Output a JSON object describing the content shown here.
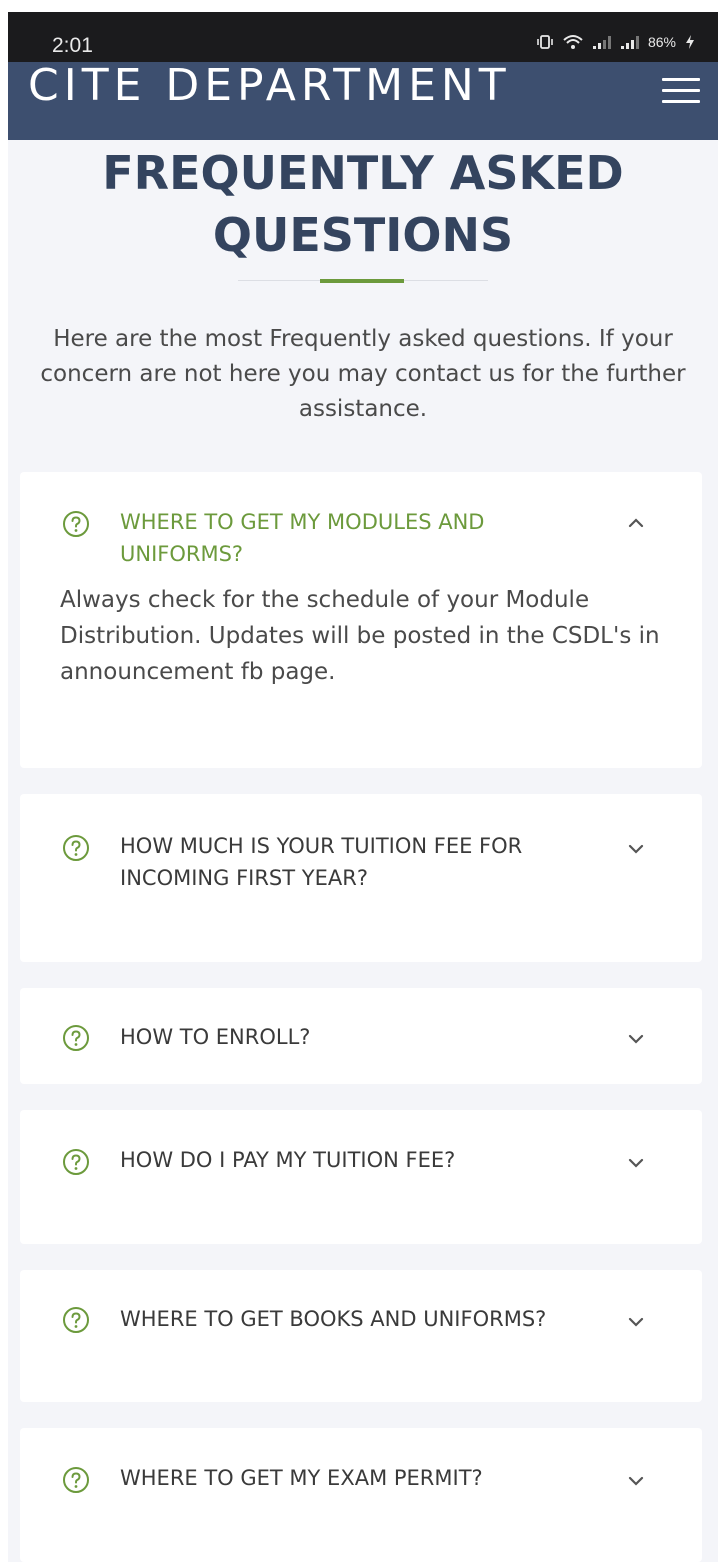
{
  "status_bar": {
    "time": "2:01",
    "battery": "86%",
    "icons": [
      "vibrate-icon",
      "wifi-icon",
      "signal-icon",
      "signal-icon",
      "battery-charging-icon"
    ]
  },
  "header": {
    "title": "CITE DEPARTMENT",
    "menu_icon": "hamburger-menu-icon"
  },
  "page": {
    "title_line1": "FREQUENTLY ASKED",
    "title_line2": "QUESTIONS",
    "intro": "Here are the most Frequently asked questions. If your concern are not here you may contact us for the further assistance."
  },
  "faq": [
    {
      "question": "WHERE TO GET MY MODULES AND UNIFORMS?",
      "expanded": true,
      "answer": "Always check for the schedule of your Module Distribution. Updates will be posted in the CSDL's in announcement fb page."
    },
    {
      "question": "HOW MUCH IS YOUR TUITION FEE FOR INCOMING FIRST YEAR?",
      "expanded": false
    },
    {
      "question": "HOW TO ENROLL?",
      "expanded": false
    },
    {
      "question": "HOW DO I PAY MY TUITION FEE?",
      "expanded": false
    },
    {
      "question": "WHERE TO GET BOOKS AND UNIFORMS?",
      "expanded": false
    },
    {
      "question": "WHERE TO GET MY EXAM PERMIT?",
      "expanded": false
    }
  ],
  "colors": {
    "header_bg": "#3d4f6f",
    "title_color": "#34445f",
    "accent_green": "#6c9a3c",
    "page_bg": "#f4f5f9",
    "card_bg": "#ffffff"
  }
}
